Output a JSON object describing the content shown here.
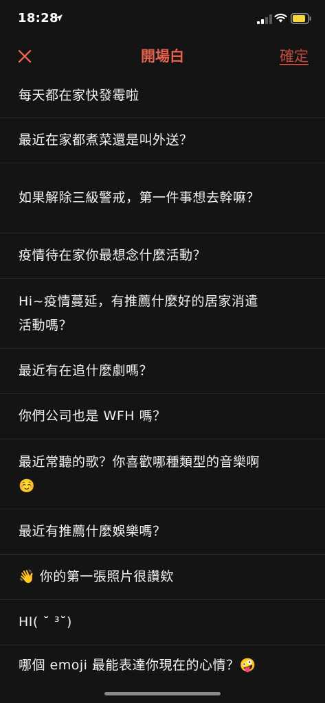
{
  "status": {
    "time": "18:28"
  },
  "nav": {
    "title": "開場白",
    "confirm_label": "確定",
    "close_icon": "close-icon",
    "accent_color": "#e8624f"
  },
  "items": [
    {
      "text": "每天都在家快發霉啦"
    },
    {
      "text": "最近在家都煮菜還是叫外送？"
    },
    {
      "text": "如果解除三級警戒，第一件事想去幹嘛？"
    },
    {
      "text": "疫情待在家你最想念什麼活動？"
    },
    {
      "text": "Hi~疫情蔓延，有推薦什麼好的居家消遣活動嗎？"
    },
    {
      "text": "最近有在追什麼劇嗎？"
    },
    {
      "text": "你們公司也是 WFH 嗎？"
    },
    {
      "text": "最近常聽的歌？你喜歡哪種類型的音樂啊☺️"
    },
    {
      "text": "最近有推薦什麼娛樂嗎？"
    },
    {
      "text": "👋 你的第一張照片很讚欸"
    },
    {
      "text": "HI( ˘ ³˘)"
    },
    {
      "text": "哪個 emoji 最能表達你現在的心情？🤪"
    }
  ]
}
